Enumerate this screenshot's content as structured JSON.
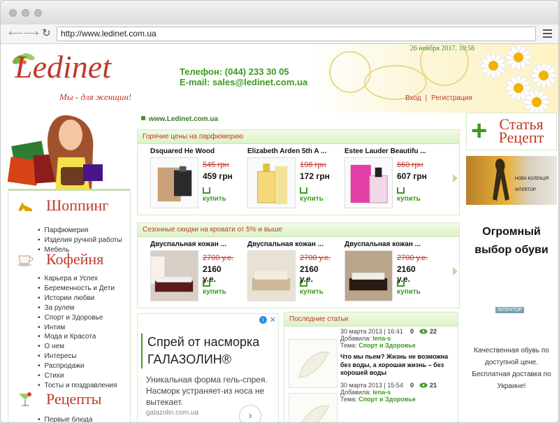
{
  "browser": {
    "url": "http://www.ledinet.com.ua"
  },
  "header": {
    "logo_text": "Ledinet",
    "logo_tagline": "Мы - для женщин!",
    "phone": "Телефон: (044) 233 30 05",
    "email": "E-mail: sales@ledinet.com.ua",
    "datetime": "26 ноября 2017, 10:56",
    "login": "Вход",
    "sep": "|",
    "register": "Регистрация"
  },
  "breadcrumb": "www.Ledinet.com.ua",
  "sidebar": {
    "sections": [
      {
        "title": "Шоппинг",
        "icon": "high-heel-icon",
        "items": [
          "Парфюмерия",
          "Изделия ручной работы",
          "Мебель"
        ]
      },
      {
        "title": "Кофейня",
        "icon": "coffee-cup-icon",
        "items": [
          "Карьера и Успех",
          "Беременность и Дети",
          "Истории любви",
          "За рулем",
          "Спорт и Здоровье",
          "Интим",
          "Мода и Красота",
          "О нем",
          "Интересы",
          "Распродажи",
          "Стихи",
          "Тосты и поздравления"
        ]
      },
      {
        "title": "Рецепты",
        "icon": "cocktail-icon",
        "items": [
          "Первые блюда"
        ]
      }
    ]
  },
  "hot_prices": {
    "title": "Горячие цены на парфюмерию",
    "products": [
      {
        "name": "Dsquared He Wood",
        "old_price": "545 грн",
        "price": "459 грн",
        "buy": "купить"
      },
      {
        "name": "Elizabeth Arden 5th A ...",
        "old_price": "198 грн",
        "price": "172 грн",
        "buy": "купить"
      },
      {
        "name": "Estee Lauder Beautifu ...",
        "old_price": "660 грн",
        "price": "607 грн",
        "buy": "купить"
      }
    ]
  },
  "bed_sale": {
    "title": "Сезонные скидки на кровати от 5% и выше",
    "products": [
      {
        "name": "Двуспальная кожан ...",
        "old_price": "2700 у.е.",
        "price": "2160 у.е.",
        "buy": "купить"
      },
      {
        "name": "Двуспальная кожан ...",
        "old_price": "2700 у.е.",
        "price": "2160 у.е.",
        "buy": "купить"
      },
      {
        "name": "Двуспальная кожан ...",
        "old_price": "2700 у.е.",
        "price": "2160 у.е.",
        "buy": "купить"
      }
    ]
  },
  "ad": {
    "headline": "Спрей от насморка ГАЛАЗОЛИН®",
    "description": "Уникальная форма гель-спрея. Насморк устраняет-из носа не вытекает.",
    "url": "galazolin.com.ua"
  },
  "articles": {
    "title": "Последние статьи",
    "added_label": "Добавила:",
    "topic_label": "Тема:",
    "items": [
      {
        "date": "30 марта 2013 | 16:41",
        "comments": "0",
        "views": "22",
        "author": "lena-s",
        "topic": "Спорт и Здоровье",
        "title": "Что мы пьем? Жизнь не возможна без воды, а хорошая жизнь – без хорошей воды"
      },
      {
        "date": "30 марта 2013 | 15:54",
        "comments": "0",
        "views": "21",
        "author": "lena-s",
        "topic": "Спорт и Здоровье",
        "title": ""
      }
    ]
  },
  "right": {
    "statja_line1": "Статья",
    "statja_line2": "Рецепт",
    "banner_line1": "НОВА КОЛЕКЦІЯ",
    "banner_line2": "INTERTOP",
    "shoes_headline": "Огромный выбор обуви",
    "shoes_button": "INTERTOP",
    "shoes_text": "Качественная обувь по доступной цене. Бесплатная доставка по Украине!"
  },
  "colors": {
    "accent_red": "#c0392b",
    "accent_green": "#3c9a1e",
    "panel_green": "#dcf2c8"
  }
}
